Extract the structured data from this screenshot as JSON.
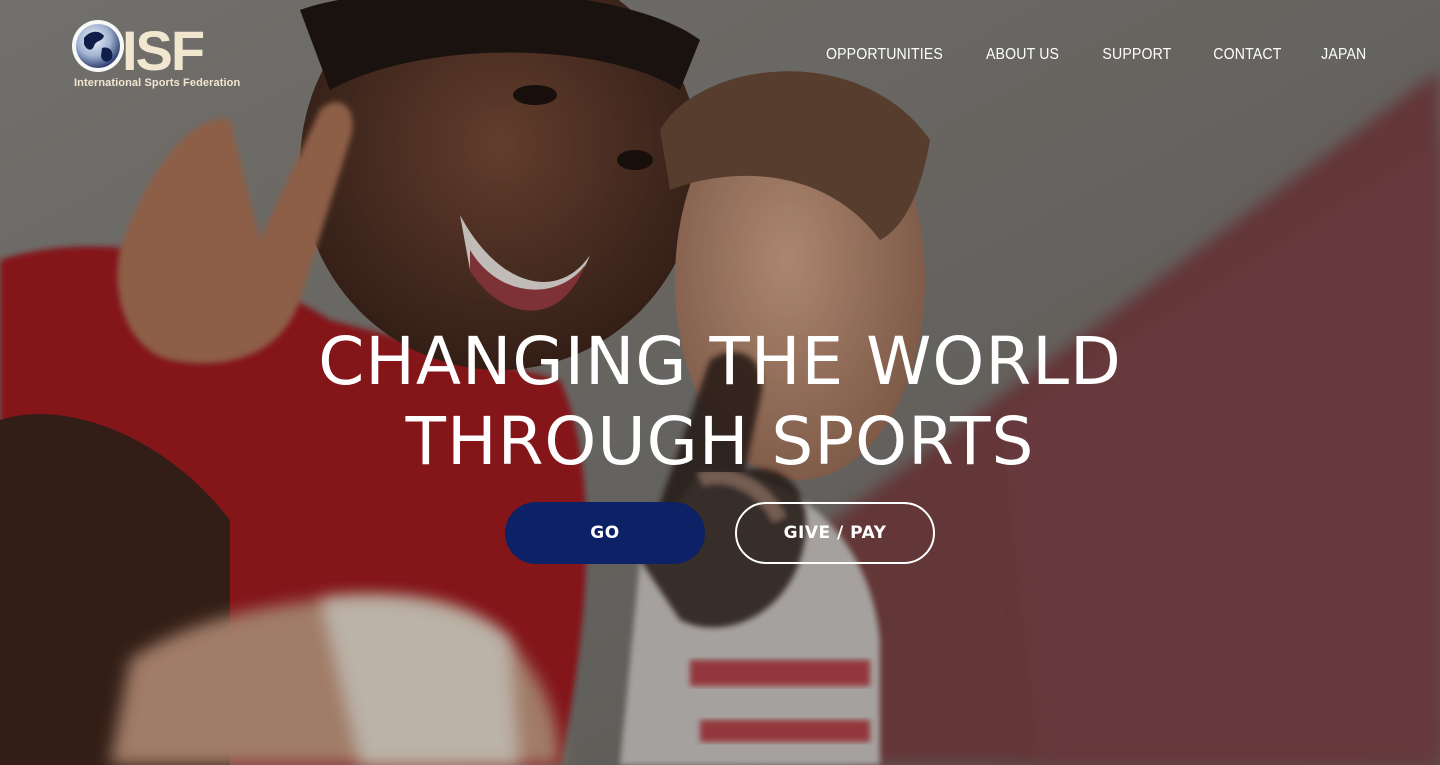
{
  "logo": {
    "wordmark": "ISF",
    "tagline": "International Sports Federation",
    "icon": "globe-icon"
  },
  "nav": {
    "items": [
      {
        "label": "OPPORTUNITIES"
      },
      {
        "label": "ABOUT US"
      },
      {
        "label": "SUPPORT"
      },
      {
        "label": "CONTACT"
      },
      {
        "label": "JAPAN"
      }
    ]
  },
  "hero": {
    "headline_line1": "CHANGING THE WORLD",
    "headline_line2": "THROUGH SPORTS",
    "primary_button": "GO",
    "secondary_button": "GIVE / PAY",
    "image": "two smiling boys making peace signs"
  },
  "colors": {
    "primary_button": "#0d2266",
    "text": "#ffffff",
    "logo_text": "#f1e7d0"
  }
}
